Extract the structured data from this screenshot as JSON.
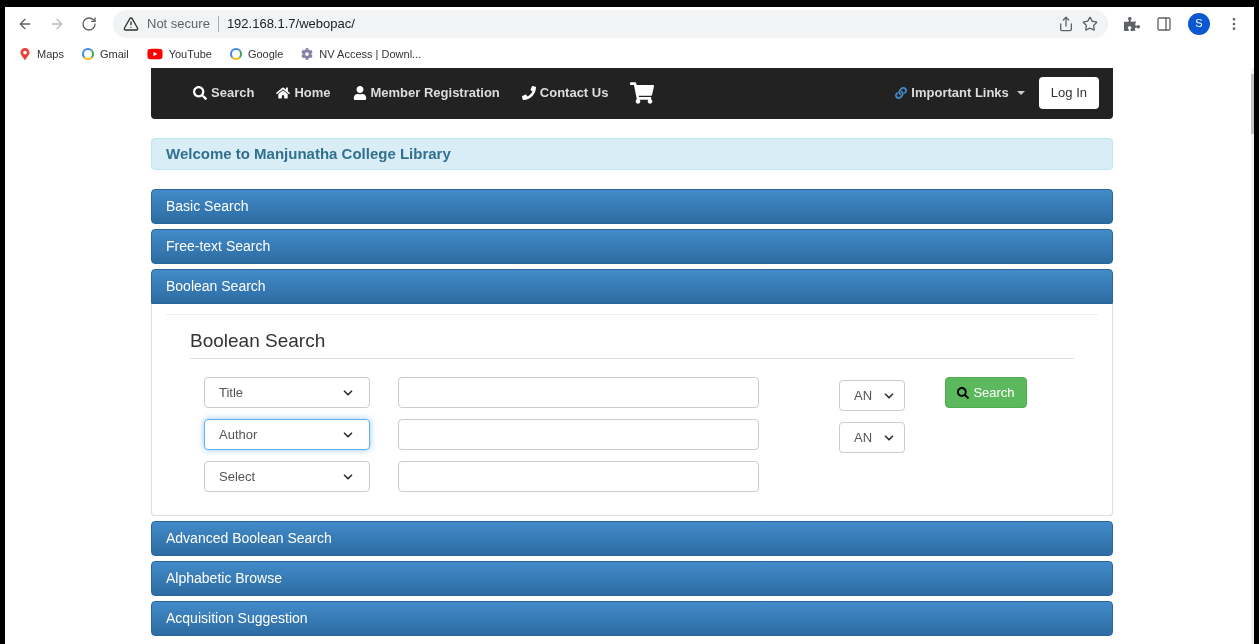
{
  "browser": {
    "security": "Not secure",
    "url": "192.168.1.7/webopac/",
    "profile": "S",
    "bookmarks": [
      {
        "label": "Maps",
        "kind": "maps"
      },
      {
        "label": "Gmail",
        "kind": "google"
      },
      {
        "label": "YouTube",
        "kind": "youtube"
      },
      {
        "label": "Google",
        "kind": "google"
      },
      {
        "label": "NV Access | Downl...",
        "kind": "gear"
      }
    ]
  },
  "navbar": {
    "items": [
      {
        "label": "Search",
        "kind": "search"
      },
      {
        "label": "Home",
        "kind": "home"
      },
      {
        "label": "Member Registration",
        "kind": "user"
      },
      {
        "label": "Contact Us",
        "kind": "phone"
      },
      {
        "kind": "cart"
      }
    ],
    "links": "Important Links",
    "login": "Log In"
  },
  "welcome": "Welcome to Manjunatha College Library",
  "panels": [
    {
      "title": "Basic Search",
      "expanded": false
    },
    {
      "title": "Free-text Search",
      "expanded": false
    },
    {
      "title": "Boolean Search",
      "expanded": true
    },
    {
      "title": "Advanced Boolean Search",
      "expanded": false
    },
    {
      "title": "Alphabetic Browse",
      "expanded": false
    },
    {
      "title": "Acquisition Suggestion",
      "expanded": false
    }
  ],
  "boolean": {
    "heading": "Boolean Search",
    "rows": [
      {
        "field": "Title",
        "focused": false,
        "operator": "AN"
      },
      {
        "field": "Author",
        "focused": true,
        "operator": "AN"
      },
      {
        "field": "Select",
        "focused": false
      }
    ],
    "button": "Search"
  }
}
